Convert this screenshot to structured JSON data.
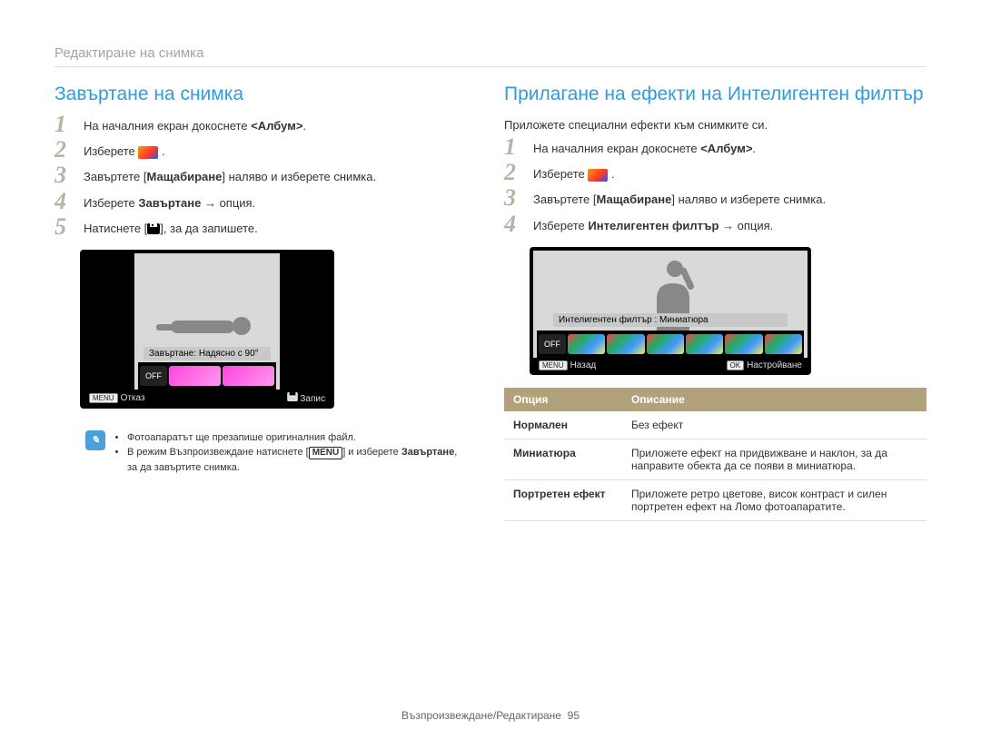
{
  "breadcrumb": "Редактиране на снимка",
  "left": {
    "title": "Завъртане на снимка",
    "steps": [
      {
        "pre": "На началния екран докоснете ",
        "bold": "<Албум>",
        "post": "."
      },
      {
        "pre": "Изберете ",
        "icon": "thumb",
        "post": " ."
      },
      {
        "pre": "Завъртете [",
        "bold": "Мащабиране",
        "post": "] наляво и изберете снимка."
      },
      {
        "pre": "Изберете ",
        "bold": "Завъртане",
        "post": " → опция."
      },
      {
        "pre": "Натиснете [",
        "icon": "disk",
        "post": "], за да запишете."
      }
    ],
    "shot": {
      "label": "Завъртане: Надясно с 90°",
      "foot_left_key": "MENU",
      "foot_left": "Отказ",
      "foot_right_icon": "disk",
      "foot_right": "Запис",
      "off": "OFF"
    },
    "note": {
      "items": [
        "Фотоапаратът ще презапише оригиналния файл.",
        {
          "pre": "В режим Възпроизвеждане натиснете [",
          "key": "MENU",
          "mid": "] и изберете ",
          "bold": "Завъртане",
          "post": ", за да завъртите снимка."
        }
      ]
    }
  },
  "right": {
    "title": "Прилагане на ефекти на Интелигентен филтър",
    "intro": "Приложете специални ефекти към снимките си.",
    "steps": [
      {
        "pre": "На началния екран докоснете ",
        "bold": "<Албум>",
        "post": "."
      },
      {
        "pre": "Изберете ",
        "icon": "thumb",
        "post": " ."
      },
      {
        "pre": "Завъртете [",
        "bold": "Мащабиране",
        "post": "] наляво и изберете снимка."
      },
      {
        "pre": "Изберете ",
        "bold": "Интелигентен филтър",
        "post": " → опция."
      }
    ],
    "shot": {
      "label": "Интелигентен филтър : Миниатюра",
      "foot_left_key": "MENU",
      "foot_left": "Назад",
      "foot_right_key": "OK",
      "foot_right": "Настройване",
      "off": "OFF"
    },
    "table": {
      "head_option": "Опция",
      "head_desc": "Описание",
      "rows": [
        {
          "name": "Нормален",
          "desc": "Без ефект"
        },
        {
          "name": "Миниатюра",
          "desc": "Приложете ефект на придвижване и наклон, за да направите обекта да се появи в миниатюра."
        },
        {
          "name": "Портретен ефект",
          "desc": "Приложете ретро цветове, висок контраст и силен портретен ефект на Ломо фотоапаратите."
        }
      ]
    }
  },
  "footer": {
    "text": "Възпроизвеждане/Редактиране",
    "page": "95"
  }
}
